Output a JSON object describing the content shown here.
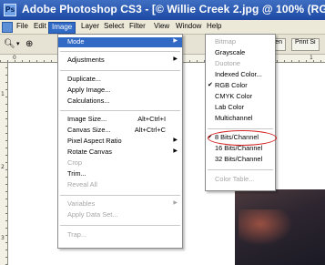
{
  "title_bar": {
    "app_icon": "Ps",
    "title": "Adobe Photoshop CS3 - [© Willie Creek 2.jpg @ 100% (RGB"
  },
  "menu_bar": {
    "items": [
      "File",
      "Edit",
      "Image",
      "Layer",
      "Select",
      "Filter",
      "View",
      "Window",
      "Help"
    ],
    "active": "Image"
  },
  "options_bar": {
    "zoom_tool": "magnifier-icon",
    "buttons": [
      "t Screen",
      "Print Si"
    ]
  },
  "rulers": {
    "top_labels": [
      "0",
      "1"
    ],
    "left_labels": [
      "1",
      "2",
      "3"
    ]
  },
  "image_menu": {
    "mode": "Mode",
    "adjustments": "Adjustments",
    "duplicate": "Duplicate...",
    "apply_image": "Apply Image...",
    "calculations": "Calculations...",
    "image_size": "Image Size...",
    "image_size_shortcut": "Alt+Ctrl+I",
    "canvas_size": "Canvas Size...",
    "canvas_size_shortcut": "Alt+Ctrl+C",
    "pixel_aspect_ratio": "Pixel Aspect Ratio",
    "rotate_canvas": "Rotate Canvas",
    "crop": "Crop",
    "trim": "Trim...",
    "reveal_all": "Reveal All",
    "variables": "Variables",
    "apply_data_set": "Apply Data Set...",
    "trap": "Trap..."
  },
  "mode_menu": {
    "bitmap": "Bitmap",
    "grayscale": "Grayscale",
    "duotone": "Duotone",
    "indexed_color": "Indexed Color...",
    "rgb_color": "RGB Color",
    "cmyk_color": "CMYK Color",
    "lab_color": "Lab Color",
    "multichannel": "Multichannel",
    "bits_8": "8 Bits/Channel",
    "bits_16": "16 Bits/Channel",
    "bits_32": "32 Bits/Channel",
    "color_table": "Color Table...",
    "checked": [
      "RGB Color",
      "8 Bits/Channel"
    ]
  },
  "colors": {
    "highlight": "#316ac5",
    "annotation_circle": "#d32020",
    "title_bar": "#1d49a4"
  }
}
